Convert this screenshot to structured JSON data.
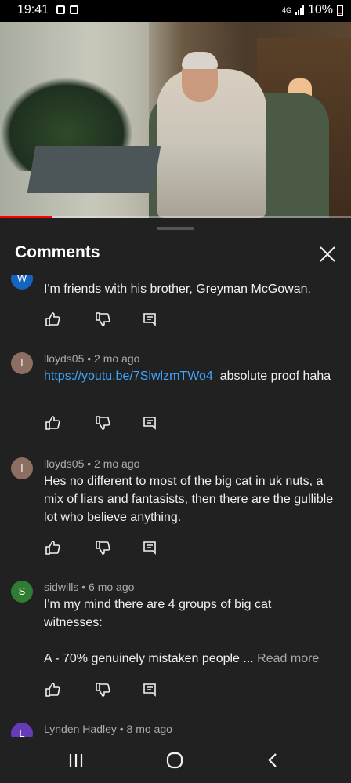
{
  "status_bar": {
    "time": "19:41",
    "network": "4G",
    "battery": "10%"
  },
  "video": {
    "progress_fraction": 0.15
  },
  "comments_panel": {
    "title": "Comments",
    "comments": [
      {
        "avatar_letter": "W",
        "avatar_color": "#1565c0",
        "meta": "",
        "text": "I'm friends with his brother, Greyman McGowan."
      },
      {
        "avatar_letter": "l",
        "avatar_color": "#8d6e63",
        "meta": "lloyds05 • 2 mo ago",
        "link": "https://youtu.be/7SlwlzmTWo4",
        "text_after_link": "  absolute proof haha"
      },
      {
        "avatar_letter": "l",
        "avatar_color": "#8d6e63",
        "meta": "lloyds05 • 2 mo ago",
        "text": "Hes no different to most of the big cat in uk nuts, a mix of liars and fantasists, then there are  the gullible lot who believe anything."
      },
      {
        "avatar_letter": "S",
        "avatar_color": "#2e7d32",
        "meta": "sidwills • 6 mo ago",
        "text_line1": "I'm my mind there are 4 groups of big cat witnesses:",
        "text_line2": "A - 70% genuinely mistaken people ...",
        "read_more": "Read more"
      },
      {
        "avatar_letter": "L",
        "avatar_color": "#673ab7",
        "meta": "Lynden Hadley • 8 mo ago"
      }
    ]
  },
  "icons": {
    "like": "thumbs-up-icon",
    "dislike": "thumbs-down-icon",
    "reply": "reply-icon",
    "close": "close-icon"
  }
}
